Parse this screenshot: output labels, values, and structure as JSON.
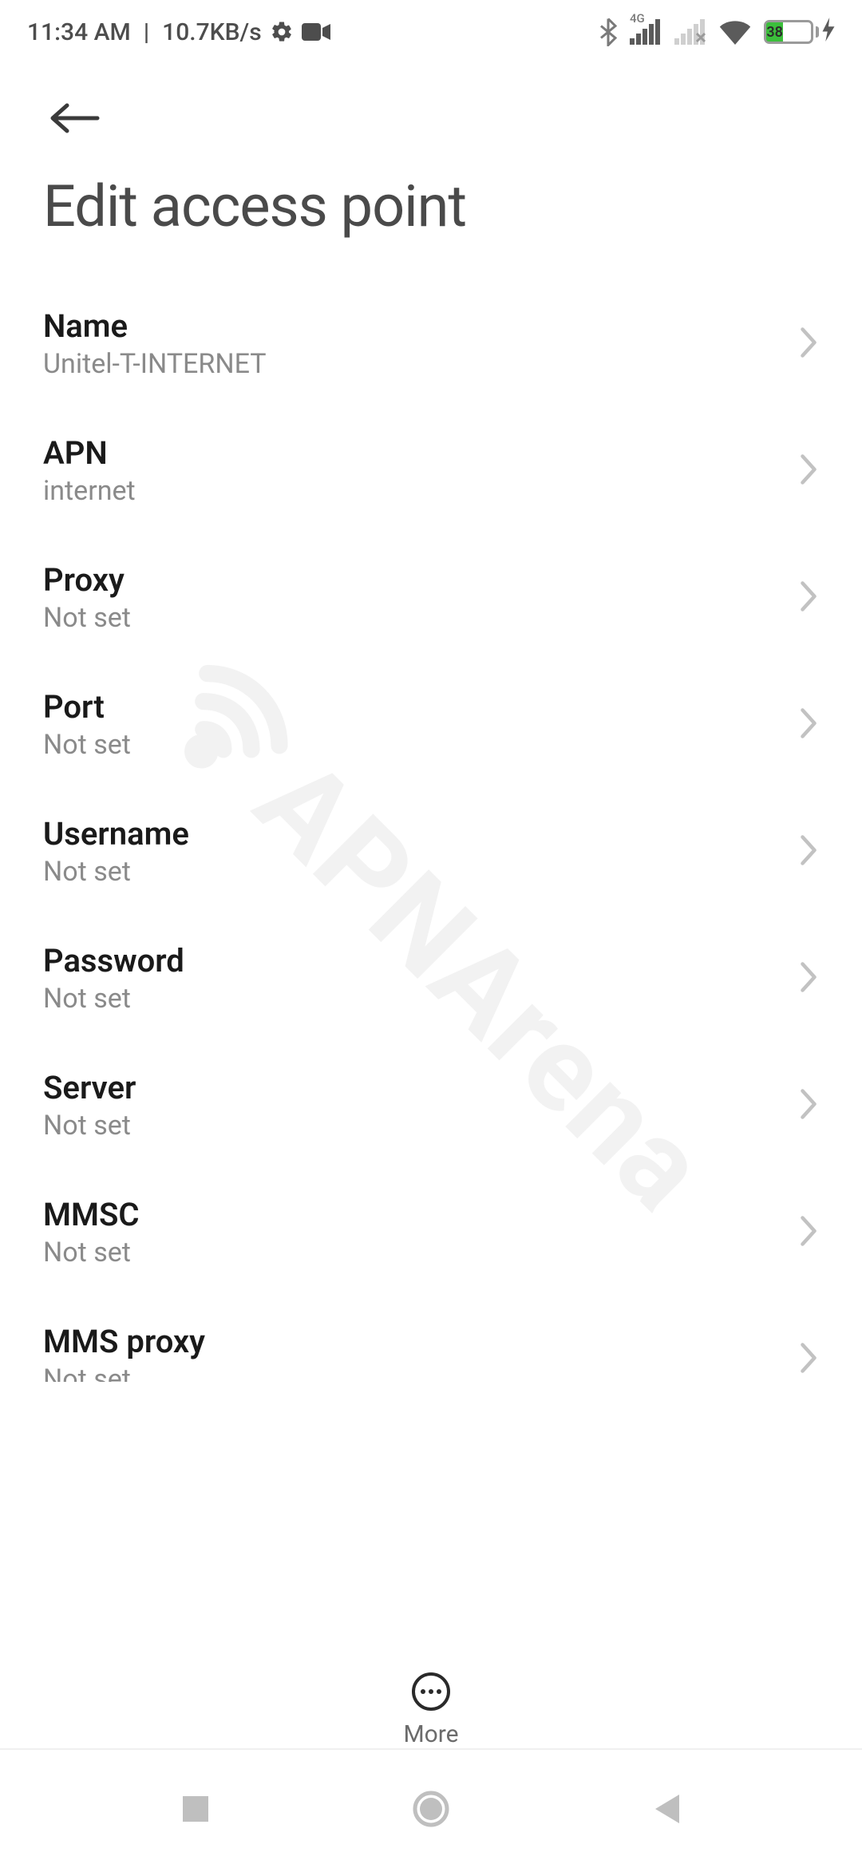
{
  "status": {
    "time": "11:34 AM",
    "rate": "10.7KB/s",
    "network_gen": "4G",
    "battery_pct": "38"
  },
  "header": {
    "title": "Edit access point"
  },
  "settings": [
    {
      "label": "Name",
      "value": "Unitel-T-INTERNET"
    },
    {
      "label": "APN",
      "value": "internet"
    },
    {
      "label": "Proxy",
      "value": "Not set"
    },
    {
      "label": "Port",
      "value": "Not set"
    },
    {
      "label": "Username",
      "value": "Not set"
    },
    {
      "label": "Password",
      "value": "Not set"
    },
    {
      "label": "Server",
      "value": "Not set"
    },
    {
      "label": "MMSC",
      "value": "Not set"
    },
    {
      "label": "MMS proxy",
      "value": "Not set"
    }
  ],
  "toolbar": {
    "more_label": "More"
  },
  "watermark": {
    "text": "APNArena"
  }
}
